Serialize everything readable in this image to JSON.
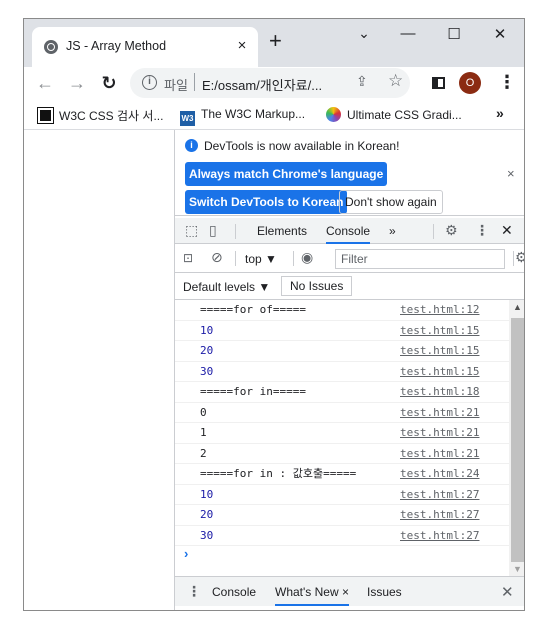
{
  "tab": {
    "title": "JS - Array Method",
    "close": "×",
    "new_tab": "+"
  },
  "window_controls": {
    "minimize": "—",
    "maximize": "☐",
    "close": "✕",
    "chevron": "⌄"
  },
  "toolbar": {
    "back": "←",
    "forward": "→",
    "reload": "↻",
    "url_scheme": "파일",
    "url": "E:/ossam/개인자료/...",
    "avatar_letter": "O",
    "menu": "⋮",
    "share": "⇪",
    "star": "☆"
  },
  "bookmarks": [
    {
      "label": "W3C CSS 검사 서..."
    },
    {
      "label": "The W3C Markup..."
    },
    {
      "label": "Ultimate CSS Gradi..."
    }
  ],
  "bookmarks_more": "»",
  "devtools": {
    "notice": {
      "text": "DevTools is now available in Korean!",
      "btn_match": "Always match Chrome's language",
      "btn_switch": "Switch DevTools to Korean",
      "btn_dont_show": "Don't show again",
      "close": "×"
    },
    "tabs": {
      "elements": "Elements",
      "console": "Console",
      "more": "»"
    },
    "console_toolbar": {
      "context": "top ▼",
      "filter_placeholder": "Filter",
      "levels": "Default levels ▼",
      "issues": "No Issues"
    },
    "logs": [
      {
        "msg": "=====for of=====",
        "src": "test.html:12",
        "type": "str"
      },
      {
        "msg": "10",
        "src": "test.html:15",
        "type": "num"
      },
      {
        "msg": "20",
        "src": "test.html:15",
        "type": "num"
      },
      {
        "msg": "30",
        "src": "test.html:15",
        "type": "num"
      },
      {
        "msg": "=====for in=====",
        "src": "test.html:18",
        "type": "str"
      },
      {
        "msg": "0",
        "src": "test.html:21",
        "type": "str"
      },
      {
        "msg": "1",
        "src": "test.html:21",
        "type": "str"
      },
      {
        "msg": "2",
        "src": "test.html:21",
        "type": "str"
      },
      {
        "msg": "=====for in : 값호출=====",
        "src": "test.html:24",
        "type": "str"
      },
      {
        "msg": "10",
        "src": "test.html:27",
        "type": "num"
      },
      {
        "msg": "20",
        "src": "test.html:27",
        "type": "num"
      },
      {
        "msg": "30",
        "src": "test.html:27",
        "type": "num"
      }
    ],
    "prompt": "›",
    "drawer": {
      "console": "Console",
      "whats_new": "What's New",
      "whats_new_close": "×",
      "issues": "Issues",
      "close": "✕"
    }
  }
}
